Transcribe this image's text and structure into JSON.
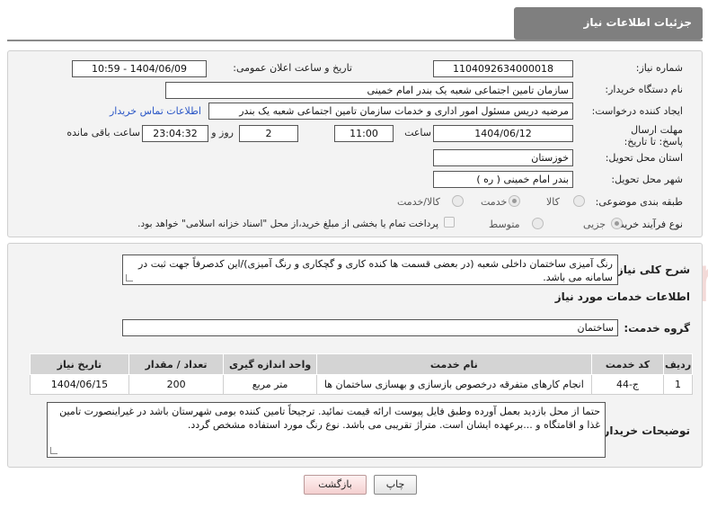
{
  "header": {
    "title": "جزئیات اطلاعات نیاز"
  },
  "form": {
    "need_number": {
      "label": "شماره نیاز:",
      "value": "1104092634000018"
    },
    "announce_datetime": {
      "label": "تاریخ و ساعت اعلان عمومی:",
      "value": "1404/06/09 - 10:59"
    },
    "buyer_org": {
      "label": "نام دستگاه خریدار:",
      "value": "سازمان تامین اجتماعی شعبه یک بندر امام خمینی"
    },
    "requester": {
      "label": "ایجاد کننده درخواست:",
      "value": "مرضیه دریس مسئول امور اداری و خدمات سازمان تامین اجتماعی شعبه یک بندر",
      "contact_link": "اطلاعات تماس خریدار"
    },
    "deadline": {
      "label": "مهلت ارسال پاسخ: تا تاریخ:",
      "date": "1404/06/12",
      "time_label": "ساعت",
      "time": "11:00",
      "days": "2",
      "days_label": "روز و",
      "remaining": "23:04:32",
      "remaining_label": "ساعت باقی مانده"
    },
    "province": {
      "label": "استان محل تحویل:",
      "value": "خوزستان"
    },
    "city": {
      "label": "شهر محل تحویل:",
      "value": "بندر امام خمینی ( ره )"
    },
    "category": {
      "label": "طبقه بندی موضوعی:",
      "options": [
        "کالا",
        "خدمت",
        "کالا/خدمت"
      ],
      "selected": "خدمت"
    },
    "purchase_process": {
      "label": "نوع فرآیند خرید :",
      "options": [
        "جزیی",
        "متوسط"
      ],
      "selected": "جزیی",
      "payment_note": "پرداخت تمام یا بخشی از مبلغ خرید،از محل \"اسناد خزانه اسلامی\" خواهد بود."
    }
  },
  "summary": {
    "label": "شرح کلی نیاز:",
    "text": "رنگ آمیزی ساختمان داخلی شعبه (در بعضی قسمت ها کنده کاری و گچکاری و رنگ آمیزی)/این کدصرفاً جهت ثبت در سامانه می باشد."
  },
  "services": {
    "section_title": "اطلاعات خدمات مورد نیاز",
    "group_label": "گروه خدمت:",
    "group_value": "ساختمان",
    "columns": [
      "ردیف",
      "کد خدمت",
      "نام خدمت",
      "واحد اندازه گیری",
      "تعداد / مقدار",
      "تاریخ نیاز"
    ],
    "rows": [
      [
        "1",
        "ج-44",
        "انجام کارهای متفرقه درخصوص بازسازی و بهسازی ساختمان ها",
        "متر مربع",
        "200",
        "1404/06/15"
      ]
    ]
  },
  "buyer_notes": {
    "label": "توضیحات خریدار:",
    "text": "حتما از محل بازدید بعمل آورده وطبق فایل پیوست ارائه قیمت نمائید. ترجیحاً تامین کننده بومی شهرستان باشد در غیراینصورت تامین غذا و اقامتگاه و ...برعهده ایشان است. متراژ تقریبی می باشد. نوع رنگ مورد استفاده مشخص گردد."
  },
  "buttons": {
    "print": "چاپ",
    "back": "بازگشت"
  },
  "watermark": "AriaTender.net",
  "colors": {
    "header_bg": "#7f7f7f",
    "link": "#2a56c6",
    "watermark": "#c0392b"
  }
}
